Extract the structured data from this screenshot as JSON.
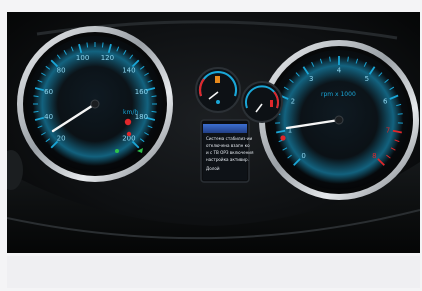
{
  "photo": {
    "subject": "car instrument cluster at night",
    "accent_color": "#1aa7d8",
    "needle_color": "#f5f5f5",
    "chrome_color": "#cfd3d8",
    "speedometer": {
      "ticks": [
        "20",
        "40",
        "60",
        "80",
        "100",
        "120",
        "140",
        "160",
        "180",
        "200"
      ],
      "unit": "km/h"
    },
    "tachometer": {
      "ticks": [
        "0",
        "1",
        "2",
        "3",
        "4",
        "5",
        "6",
        "7",
        "8"
      ],
      "unit": "rpm x 1000"
    },
    "display": {
      "lines": [
        "",
        "Система стабилиз-ии",
        "отключена взапн ко",
        "и с ТВ ОРЗ включения",
        "настройка активир.",
        "Долой"
      ]
    },
    "indicators": {
      "fuel_icon": "fuel-pump-icon",
      "temp_icon": "thermometer-icon",
      "warning_color": "#e0272b",
      "ok_color": "#2ec24a"
    }
  },
  "caption": {
    "text": ""
  }
}
